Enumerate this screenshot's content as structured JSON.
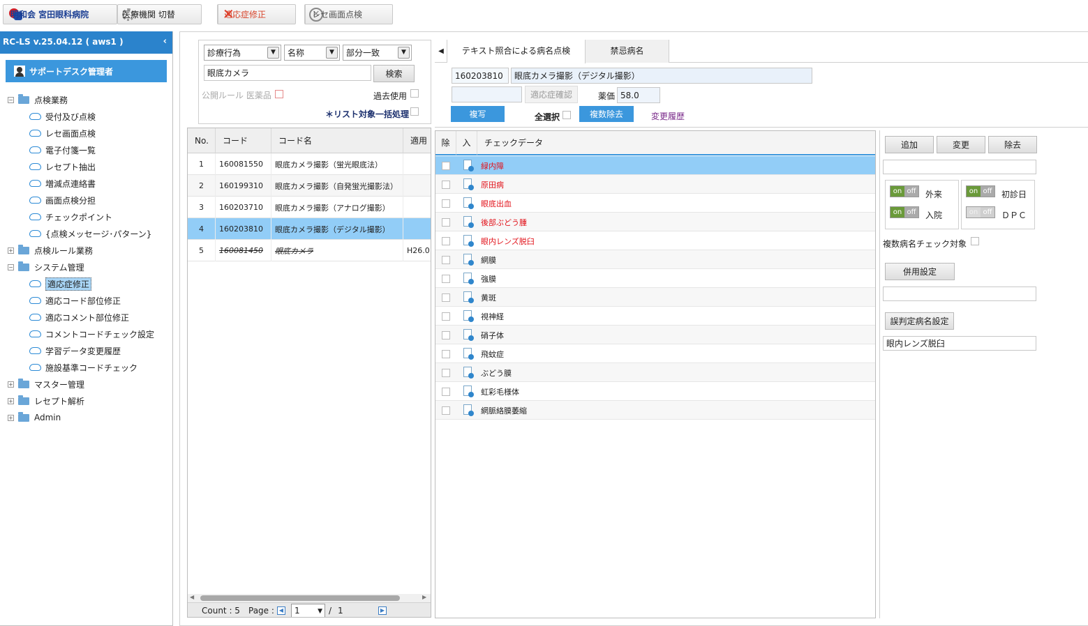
{
  "topbar": {
    "hospital": "明和会 宮田眼科病院",
    "switch_label": "医療機関 切替",
    "tab_active": "適応症修正",
    "tab_inactive": "レセ画面点検"
  },
  "sidebar": {
    "version": "RC-LS v.25.04.12 ( aws1 )",
    "user": "サポートデスク管理者",
    "tree": [
      {
        "label": "点検業務",
        "type": "folder",
        "expanded": true
      },
      {
        "label": "受付及び点検",
        "type": "leaf"
      },
      {
        "label": "レセ画面点検",
        "type": "leaf"
      },
      {
        "label": "電子付箋一覧",
        "type": "leaf"
      },
      {
        "label": "レセプト抽出",
        "type": "leaf"
      },
      {
        "label": "増減点連絡書",
        "type": "leaf"
      },
      {
        "label": "画面点検分担",
        "type": "leaf"
      },
      {
        "label": "チェックポイント",
        "type": "leaf"
      },
      {
        "label": "{点検メッセージ･パターン}",
        "type": "leaf"
      },
      {
        "label": "点検ルール業務",
        "type": "folder",
        "expanded": false
      },
      {
        "label": "システム管理",
        "type": "folder",
        "expanded": true
      },
      {
        "label": "適応症修正",
        "type": "leaf",
        "selected": true
      },
      {
        "label": "適応コード部位修正",
        "type": "leaf"
      },
      {
        "label": "適応コメント部位修正",
        "type": "leaf"
      },
      {
        "label": "コメントコードチェック設定",
        "type": "leaf"
      },
      {
        "label": "学習データ変更履歴",
        "type": "leaf"
      },
      {
        "label": "施設基準コードチェック",
        "type": "leaf"
      },
      {
        "label": "マスター管理",
        "type": "folder",
        "expanded": false
      },
      {
        "label": "レセプト解析",
        "type": "folder",
        "expanded": false
      },
      {
        "label": "Admin",
        "type": "folder",
        "expanded": false
      }
    ]
  },
  "search": {
    "category": "診療行為",
    "field": "名称",
    "match": "部分一致",
    "keyword": "眼底カメラ",
    "search_button": "検索",
    "public_rule_label": "公開ルール 医薬品",
    "past_use_label": "過去使用",
    "batch_label": "＊リスト対象一括処理"
  },
  "code_grid": {
    "headers": [
      "No.",
      "コード",
      "コード名",
      "適用"
    ],
    "rows": [
      {
        "no": "1",
        "code": "160081550",
        "name": "眼底カメラ撮影（蛍光眼底法）",
        "apply": ""
      },
      {
        "no": "2",
        "code": "160199310",
        "name": "眼底カメラ撮影（自発蛍光撮影法）",
        "apply": ""
      },
      {
        "no": "3",
        "code": "160203710",
        "name": "眼底カメラ撮影（アナログ撮影）",
        "apply": ""
      },
      {
        "no": "4",
        "code": "160203810",
        "name": "眼底カメラ撮影（デジタル撮影）",
        "apply": ""
      },
      {
        "no": "5",
        "code": "160081450",
        "name": "眼底カメラ",
        "apply": "H26.0"
      }
    ],
    "selected_row": 4,
    "footer_count": "Count : 5",
    "footer_page_label": "Page :",
    "footer_page": "1",
    "footer_sep": "/",
    "footer_total": "1"
  },
  "detail": {
    "tab_active": "テキスト照合による病名点検",
    "tab_inactive": "禁忌病名",
    "code": "160203810",
    "name": "眼底カメラ撮影（デジタル撮影）",
    "confirm_button": "適応症確認",
    "price_label": "薬価",
    "price": "58.0",
    "copy_button": "複写",
    "select_all_label": "全選択",
    "multi_delete_button": "複数除去",
    "history_link": "変更履歴"
  },
  "check_grid": {
    "headers": [
      "除",
      "入",
      "チェックデータ"
    ],
    "rows": [
      {
        "text": "緑内障",
        "red": true
      },
      {
        "text": "原田病",
        "red": true
      },
      {
        "text": "眼底出血",
        "red": true
      },
      {
        "text": "後部ぶどう腫",
        "red": true
      },
      {
        "text": "眼内レンズ脱臼",
        "red": true
      },
      {
        "text": "網膜",
        "red": false
      },
      {
        "text": "強膜",
        "red": false
      },
      {
        "text": "黄斑",
        "red": false
      },
      {
        "text": "視神経",
        "red": false
      },
      {
        "text": "硝子体",
        "red": false
      },
      {
        "text": "飛蚊症",
        "red": false
      },
      {
        "text": "ぶどう膜",
        "red": false
      },
      {
        "text": "虹彩毛様体",
        "red": false
      },
      {
        "text": "網脈絡膜萎縮",
        "red": false
      }
    ]
  },
  "right_panel": {
    "add_button": "追加",
    "change_button": "変更",
    "remove_button": "除去",
    "toggle_on": "on",
    "toggle_off": "off",
    "outpatient": "外来",
    "inpatient": "入院",
    "first_visit": "初診日",
    "dpc": "ＤＰＣ",
    "multi_check_label": "複数病名チェック対象",
    "combined_button": "併用設定",
    "misjudge_button": "誤判定病名設定",
    "misjudge_value": "眼内レンズ脱臼"
  }
}
